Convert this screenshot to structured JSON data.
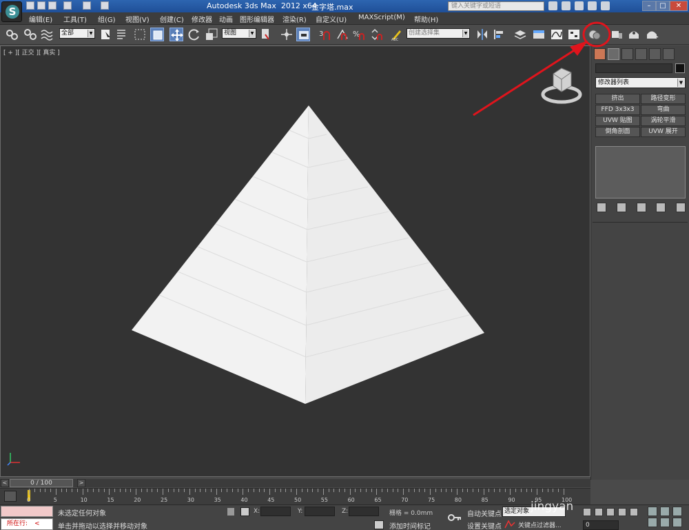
{
  "titlebar": {
    "title": "Autodesk 3ds Max  2012 x64",
    "filename": "金字塔.max",
    "search_placeholder": "键入关键字或短语"
  },
  "menu": [
    "编辑(E)",
    "工具(T)",
    "组(G)",
    "视图(V)",
    "创建(C)",
    "修改器",
    "动画",
    "图形编辑器",
    "渲染(R)",
    "自定义(U)",
    "MAXScript(M)",
    "帮助(H)"
  ],
  "toolbar": {
    "selection_filter": "全部",
    "ref_coord": "视图",
    "named_selection": "创建选择集"
  },
  "viewport": {
    "label": "[ + ][ 正交 ][ 真实 ]",
    "object": "pyramid",
    "background": "#333333"
  },
  "command_panel": {
    "modifier_list": "修改器列表",
    "buttons": [
      "挤出",
      "路径变形",
      "FFD 3x3x3",
      "弯曲",
      "UVW 贴图",
      "涡轮平滑",
      "倒角剖面",
      "UVW 展开"
    ]
  },
  "timeline": {
    "slider_label": "0 / 100",
    "ticks": [
      "0",
      "5",
      "10",
      "15",
      "20",
      "25",
      "30",
      "35",
      "40",
      "45",
      "50",
      "55",
      "60",
      "65",
      "70",
      "75",
      "80",
      "85",
      "90",
      "95",
      "100"
    ]
  },
  "status": {
    "maxscript_label": "所在行:",
    "selection_status": "未选定任何对象",
    "prompt": "单击并拖动以选择并移动对象",
    "x_label": "X:",
    "y_label": "Y:",
    "z_label": "Z:",
    "grid": "栅格 = 0.0mm",
    "add_time_tag": "添加时间标记",
    "auto_key": "自动关键点",
    "set_key": "设置关键点",
    "selected_dd": "选定对象",
    "key_filters": "关键点过滤器...",
    "current_frame": "0"
  },
  "annotation": {
    "color": "#e0141c",
    "target": "render-setup-button"
  },
  "watermark": "jingyan"
}
